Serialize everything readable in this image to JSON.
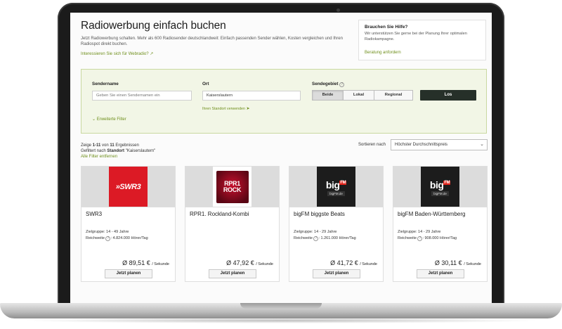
{
  "page": {
    "title": "Radiowerbung einfach buchen",
    "intro": "Jetzt Radiowerbung schalten. Mehr als 600 Radiosender deutschlandweit: Einfach passenden Sender wählen, Kosten vergleichen und Ihren Radiospot direkt buchen.",
    "webradio_link": "Interessieren Sie sich für Webradio?"
  },
  "help": {
    "title": "Brauchen Sie Hilfe?",
    "text": "Wir unterstützen Sie gerne bei der Planung Ihrer optimalen Radiokampagne.",
    "link": "Beratung anfordern"
  },
  "filters": {
    "station_label": "Sendername",
    "station_placeholder": "Geben Sie einen Sendernamen ein",
    "location_label": "Ort",
    "location_value": "Kaiserslautern",
    "location_link": "Ihren Standort verwenden",
    "area_label": "Sendegebiet",
    "area_options": [
      "Beide",
      "Lokal",
      "Regional"
    ],
    "area_selected": "Beide",
    "submit": "Los",
    "more_filters": "Erweiterte Filter"
  },
  "results": {
    "count_prefix": "Zeige",
    "range": "1-11",
    "count_mid": "von",
    "total": "11",
    "count_suffix": "Ergebnissen",
    "filter_prefix": "Gefiltert nach",
    "filter_key": "Standort",
    "filter_value": "\"Kaiserslautern\"",
    "remove_filters": "Alle Filter entfernen",
    "sort_label": "Sortieren nach",
    "sort_value": "Höchster Durchschnittspreis"
  },
  "cards": [
    {
      "logo": "SWR3",
      "logo_text": "»SWR3",
      "title": "SWR3",
      "target": "Zielgruppe: 14 - 49 Jahre",
      "reach_label": "Reichweite",
      "reach_value": "4.824.000 Hörer/Tag",
      "price": "Ø 89,51 €",
      "per": "/ Sekunde",
      "button": "Jetzt planen"
    },
    {
      "logo": "RPR1 ROCK",
      "logo_line1": "RPR1",
      "logo_line2": "ROCK",
      "title": "RPR1. Rockland-Kombi",
      "price": "Ø 47,92 €",
      "per": "/ Sekunde",
      "button": "Jetzt planen"
    },
    {
      "logo": "bigFM",
      "logo_big": "big",
      "logo_fm": "FM",
      "logo_sub": "bigFM.de",
      "title": "bigFM biggste Beats",
      "target": "Zielgruppe: 14 - 29 Jahre",
      "reach_label": "Reichweite",
      "reach_value": "1.261.000 Hörer/Tag",
      "price": "Ø 41,72 €",
      "per": "/ Sekunde",
      "button": "Jetzt planen"
    },
    {
      "logo": "bigFM",
      "logo_big": "big",
      "logo_fm": "FM",
      "logo_sub": "bigFM.de",
      "title": "bigFM Baden-Württemberg",
      "target": "Zielgruppe: 14 - 29 Jahre",
      "reach_label": "Reichweite",
      "reach_value": "908.000 Hörer/Tag",
      "price": "Ø 30,11 €",
      "per": "/ Sekunde",
      "button": "Jetzt planen"
    }
  ],
  "colors": {
    "accent_green": "#6f8f1c",
    "filter_bg": "#f2f6e6",
    "button_dark": "#263029",
    "swr3_red": "#dc1a25",
    "bigfm_black": "#1c1c1c"
  },
  "icons": [
    "external-link-icon",
    "location-arrow-icon",
    "help-circle-icon",
    "chevron-down-icon",
    "info-circle-icon",
    "caret-down-icon"
  ]
}
